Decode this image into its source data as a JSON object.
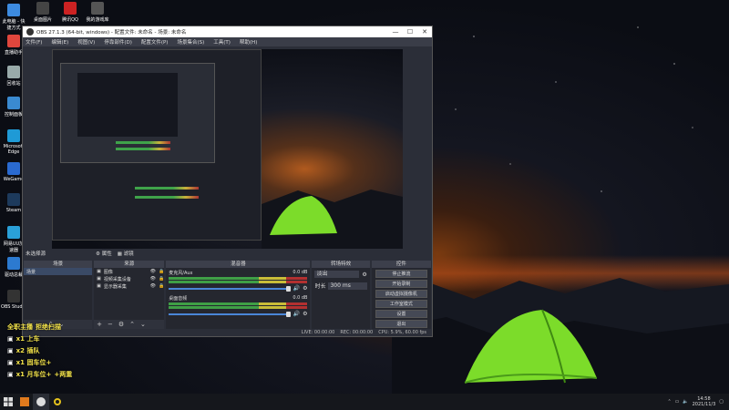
{
  "desktop_icons": [
    {
      "label": "此电脑 - 快\n捷方式",
      "color": "#3d8be0"
    },
    {
      "label": "直播助手",
      "color": "#e0463d"
    },
    {
      "label": "回收站",
      "color": "#9aa"
    },
    {
      "label": "控制面板",
      "color": "#3a8ad0"
    },
    {
      "label": "Microsoft\nEdge",
      "color": "#1f9ad6"
    },
    {
      "label": "WeGame",
      "color": "#2a6ad0"
    },
    {
      "label": "Steam",
      "color": "#1d3a5c"
    },
    {
      "label": "网易UU加\n速器",
      "color": "#2aa0d8"
    },
    {
      "label": "驱动总裁",
      "color": "#2c7ad0"
    },
    {
      "label": "OBS Studio",
      "color": "#333"
    }
  ],
  "top_icons": [
    {
      "label": "桌面图片",
      "color": "#444"
    },
    {
      "label": "腾讯QQ",
      "color": "#c22"
    },
    {
      "label": "我的游戏库",
      "color": "#555"
    }
  ],
  "window": {
    "title": "OBS 27.1.3 (64-bit, windows) - 配置文件: 未命名 - 场景: 未命名",
    "min": "—",
    "max": "☐",
    "close": "✕"
  },
  "menu": [
    "文件(F)",
    "编辑(E)",
    "视图(V)",
    "停靠部件(D)",
    "配置文件(P)",
    "场景集合(S)",
    "工具(T)",
    "帮助(H)"
  ],
  "lowerbar": {
    "no_source": "未选择源",
    "properties": "属性",
    "filters": "滤镜"
  },
  "docks": {
    "scenes": {
      "title": "场景",
      "items": [
        "场景"
      ]
    },
    "sources": {
      "title": "来源",
      "items": [
        "图像",
        "视频采集设备",
        "显示器采集"
      ]
    },
    "mixer": {
      "title": "混音器",
      "channels": [
        {
          "name": "麦克风/Aux",
          "db": "0.0 dB"
        },
        {
          "name": "桌面音频",
          "db": "0.0 dB"
        }
      ]
    },
    "transitions": {
      "title": "转场特效",
      "type": "淡出",
      "duration_label": "时长",
      "duration": "300 ms"
    },
    "controls": {
      "title": "控件",
      "buttons": [
        "停止推流",
        "开始录制",
        "启动虚拟摄像机",
        "工作室模式",
        "设置",
        "退出"
      ]
    }
  },
  "statusbar": {
    "live": "LIVE: 00:00:00",
    "rec": "REC: 00:00:00",
    "cpu": "CPU: 5.9%, 60.00 fps"
  },
  "overlay_lines": [
    {
      "text": "全职主播",
      "text2": "拒绝扫描"
    },
    {
      "text": "x1 上车",
      "text2": ""
    },
    {
      "text": "x2 插队",
      "text2": ""
    },
    {
      "text": "x1 固车位+",
      "text2": ""
    },
    {
      "text": "x1 月车位+",
      "text2": "+两重"
    }
  ],
  "taskbar": {
    "time": "14:58",
    "date": "2021/11/3"
  }
}
